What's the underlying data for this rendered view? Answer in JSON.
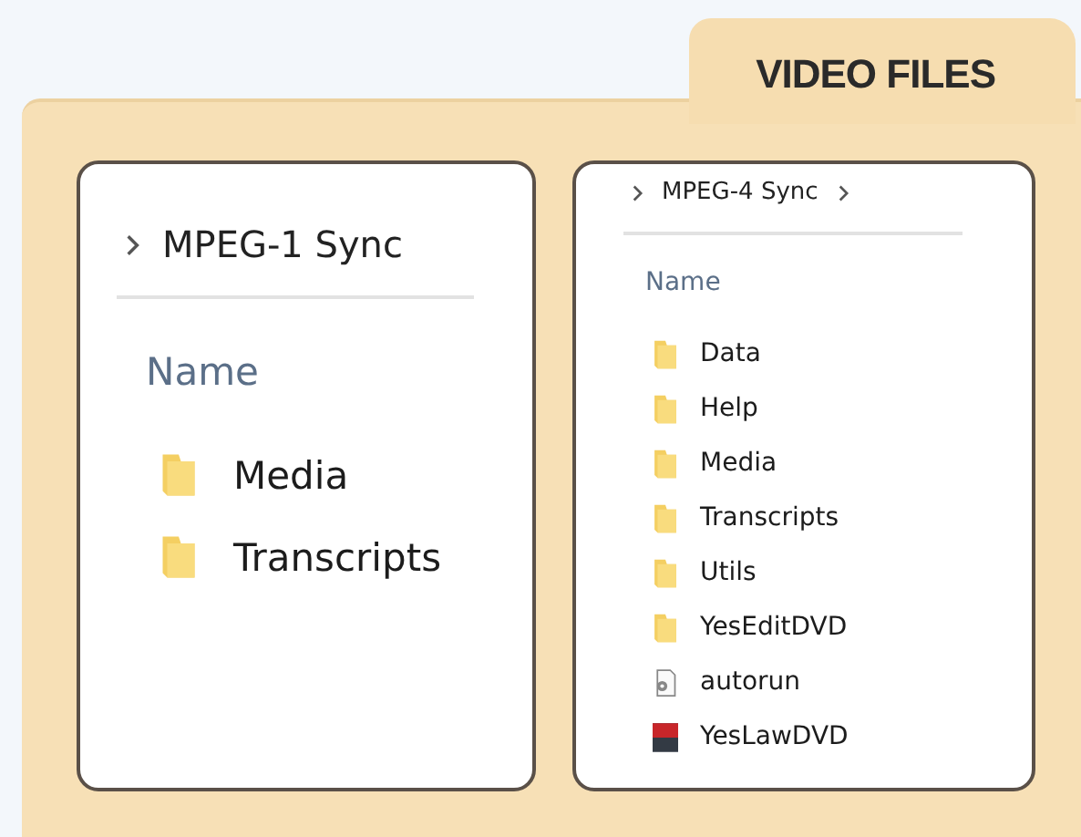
{
  "folder_tab": {
    "title": "VIDEO FILES"
  },
  "panels": [
    {
      "kind": "large",
      "path": "MPEG-1 Sync",
      "trailing_chevron": false,
      "column": "Name",
      "items": [
        {
          "name": "Media",
          "kind": "folder"
        },
        {
          "name": "Transcripts",
          "kind": "folder"
        }
      ]
    },
    {
      "kind": "compact",
      "path": "MPEG-4 Sync",
      "trailing_chevron": true,
      "column": "Name",
      "items": [
        {
          "name": "Data",
          "kind": "folder"
        },
        {
          "name": "Help",
          "kind": "folder"
        },
        {
          "name": "Media",
          "kind": "folder"
        },
        {
          "name": "Transcripts",
          "kind": "folder"
        },
        {
          "name": "Utils",
          "kind": "folder"
        },
        {
          "name": "YesEditDVD",
          "kind": "folder"
        },
        {
          "name": "autorun",
          "kind": "settings-file"
        },
        {
          "name": "YesLawDVD",
          "kind": "app"
        }
      ]
    }
  ]
}
